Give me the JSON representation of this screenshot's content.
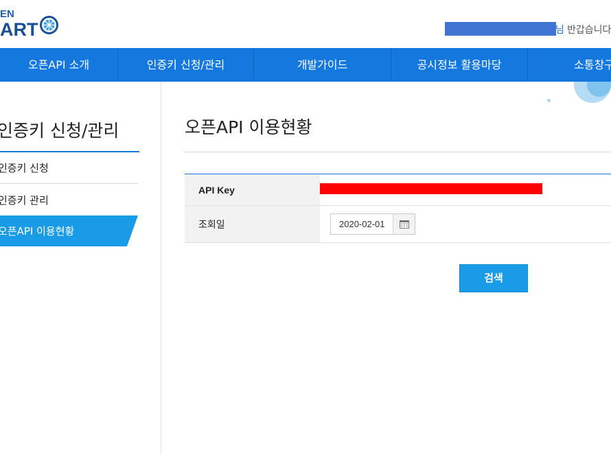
{
  "header": {
    "logo_top": "EN",
    "logo_main": "ART",
    "user_suffix": "님",
    "greeting": "반갑습니다"
  },
  "gnb": {
    "items": [
      "오픈API 소개",
      "인증키 신청/관리",
      "개발가이드",
      "공시정보 활용마당",
      "소통창구"
    ]
  },
  "sidebar": {
    "title": "인증키 신청/관리",
    "items": [
      "인증키 신청",
      "인증키 관리",
      "오픈API 이용현황"
    ],
    "active_index": 2
  },
  "main": {
    "title": "오픈API 이용현황",
    "form": {
      "api_key_label": "API Key",
      "date_label": "조회일",
      "date_value": "2020-02-01"
    },
    "search_label": "검색"
  },
  "icons": {
    "logo": "globe-logo-icon",
    "calendar": "calendar-icon"
  },
  "colors": {
    "gnb": "#1478de",
    "accent": "#1a9be8",
    "redaction_user": "#3f74d3",
    "redaction_key": "#ff0000"
  }
}
